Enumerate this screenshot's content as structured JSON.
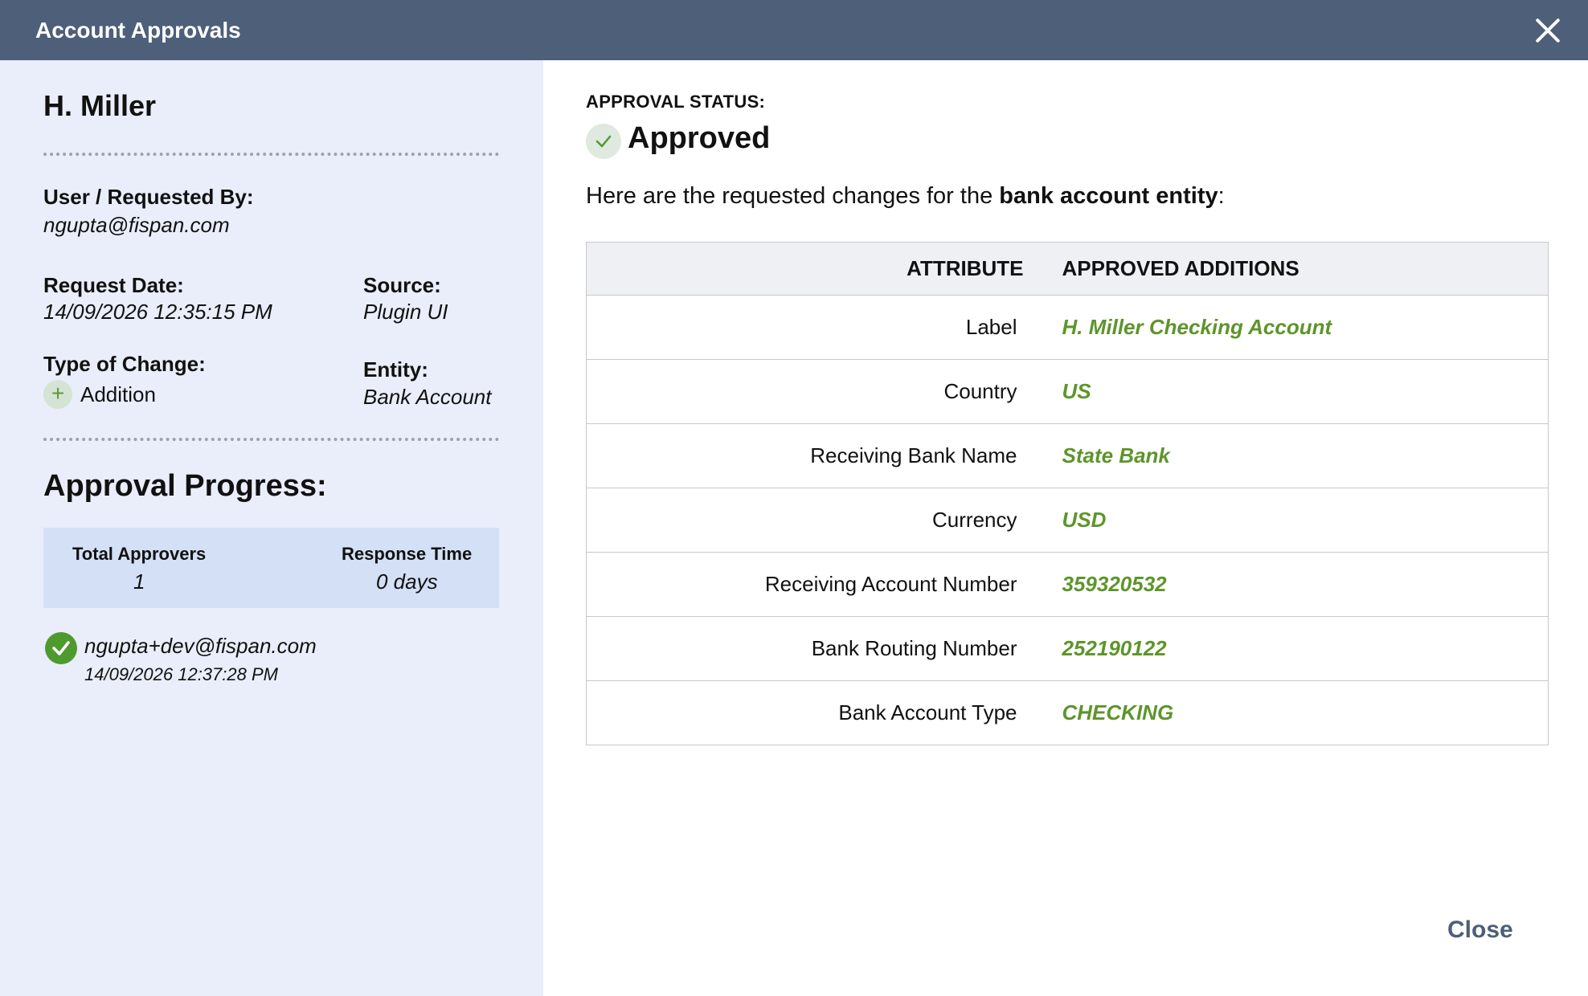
{
  "window": {
    "title": "Account Approvals",
    "close_icon": "close-icon"
  },
  "request": {
    "name": "H. Miller",
    "requested_by_label": "User / Requested By:",
    "requested_by": "ngupta@fispan.com",
    "request_date_label": "Request Date:",
    "request_date": "14/09/2026 12:35:15 PM",
    "source_label": "Source:",
    "source": "Plugin UI",
    "type_label": "Type of Change:",
    "type": "Addition",
    "entity_label": "Entity:",
    "entity": "Bank Account"
  },
  "progress": {
    "title": "Approval Progress:",
    "total_label": "Total Approvers",
    "total": "1",
    "response_label": "Response Time",
    "response": "0 days",
    "approvers": [
      {
        "email": "ngupta+dev@fispan.com",
        "time": "14/09/2026 12:37:28 PM",
        "status": "approved"
      }
    ]
  },
  "status": {
    "label": "APPROVAL STATUS:",
    "value": "Approved",
    "intro_prefix": "Here are the requested changes for the ",
    "intro_bold": "bank account entity",
    "intro_suffix": ":"
  },
  "table": {
    "headers": [
      "ATTRIBUTE",
      "APPROVED ADDITIONS"
    ],
    "rows": [
      {
        "attribute": "Label",
        "value": "H. Miller Checking Account"
      },
      {
        "attribute": "Country",
        "value": "US"
      },
      {
        "attribute": "Receiving Bank Name",
        "value": "State Bank"
      },
      {
        "attribute": "Currency",
        "value": "USD"
      },
      {
        "attribute": "Receiving Account Number",
        "value": "359320532"
      },
      {
        "attribute": "Bank Routing Number",
        "value": "252190122"
      },
      {
        "attribute": "Bank Account Type",
        "value": "CHECKING"
      }
    ]
  },
  "footer": {
    "close_label": "Close"
  },
  "colors": {
    "header": "#4d5f79",
    "left_panel": "#e9eefa",
    "accent_green": "#5d952a",
    "stats_bg": "#d3e0f6"
  }
}
